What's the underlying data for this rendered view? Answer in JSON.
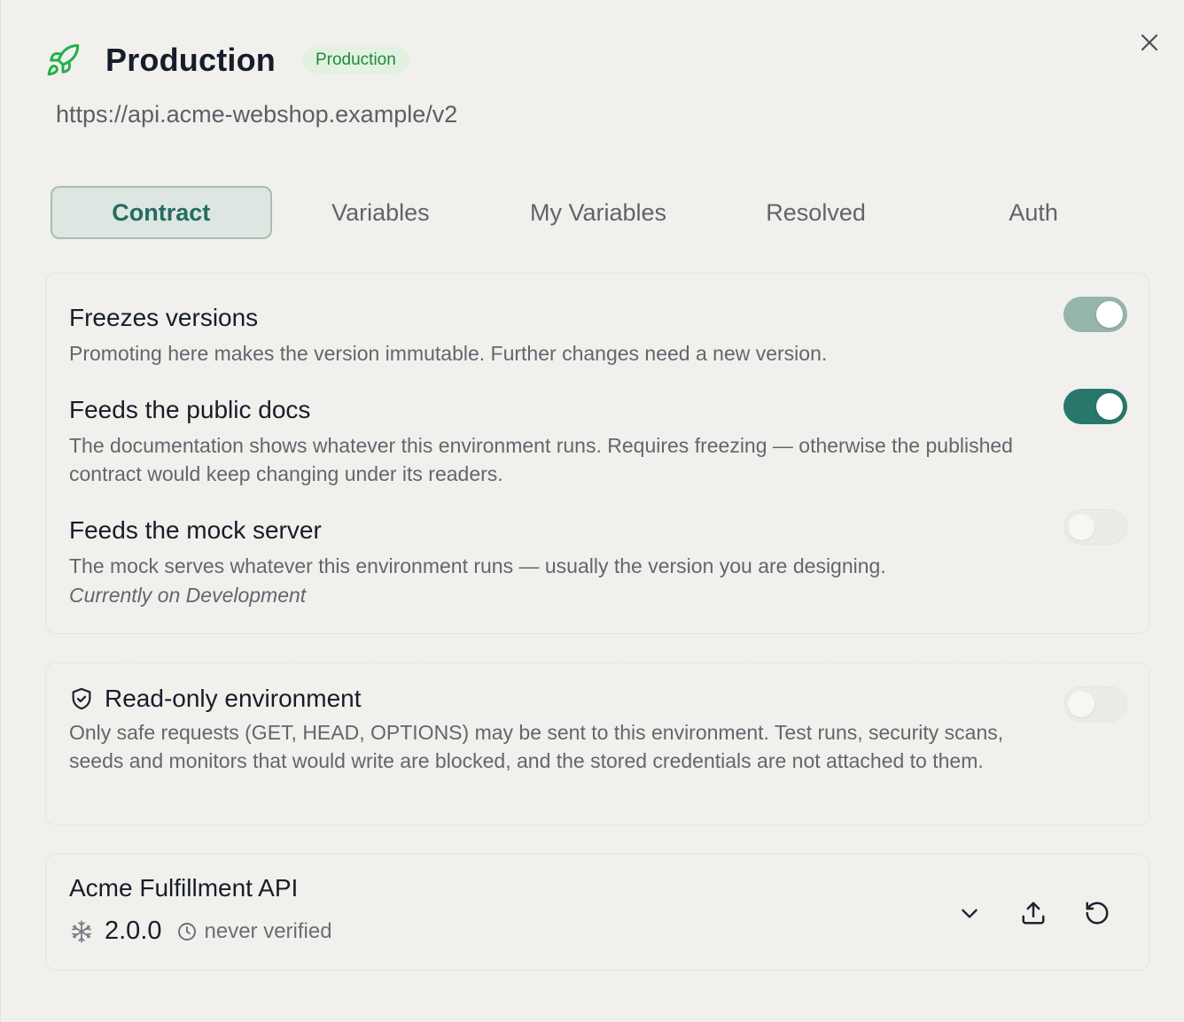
{
  "header": {
    "title": "Production",
    "badge": "Production",
    "url": "https://api.acme-webshop.example/v2"
  },
  "tabs": [
    {
      "label": "Contract",
      "active": true
    },
    {
      "label": "Variables",
      "active": false
    },
    {
      "label": "My Variables",
      "active": false
    },
    {
      "label": "Resolved",
      "active": false
    },
    {
      "label": "Auth",
      "active": false
    }
  ],
  "settings": {
    "freeze": {
      "title": "Freezes versions",
      "description": "Promoting here makes the version immutable. Further changes need a new version.",
      "enabled": true
    },
    "docs": {
      "title": "Feeds the public docs",
      "description": "The documentation shows whatever this environment runs. Requires freezing — otherwise the published contract would keep changing under its readers.",
      "enabled": true
    },
    "mock": {
      "title": "Feeds the mock server",
      "description": "The mock serves whatever this environment runs — usually the version you are designing.",
      "note": "Currently on Development",
      "enabled": false
    }
  },
  "readonly": {
    "title": "Read-only environment",
    "description": "Only safe requests (GET, HEAD, OPTIONS) may be sent to this environment. Test runs, security scans, seeds and monitors that would write are blocked, and the stored credentials are not attached to them.",
    "enabled": false
  },
  "api": {
    "name": "Acme Fulfillment API",
    "version": "2.0.0",
    "status": "never verified"
  },
  "colors": {
    "accent": "#27786b",
    "badge_bg": "#e3f1e3",
    "badge_text": "#1f8a3b",
    "rocket": "#22b04a"
  },
  "icons": [
    "rocket-icon",
    "close-icon",
    "shield-check-icon",
    "snowflake-icon",
    "clock-icon",
    "chevron-down-icon",
    "upload-icon",
    "rotate-ccw-icon"
  ]
}
